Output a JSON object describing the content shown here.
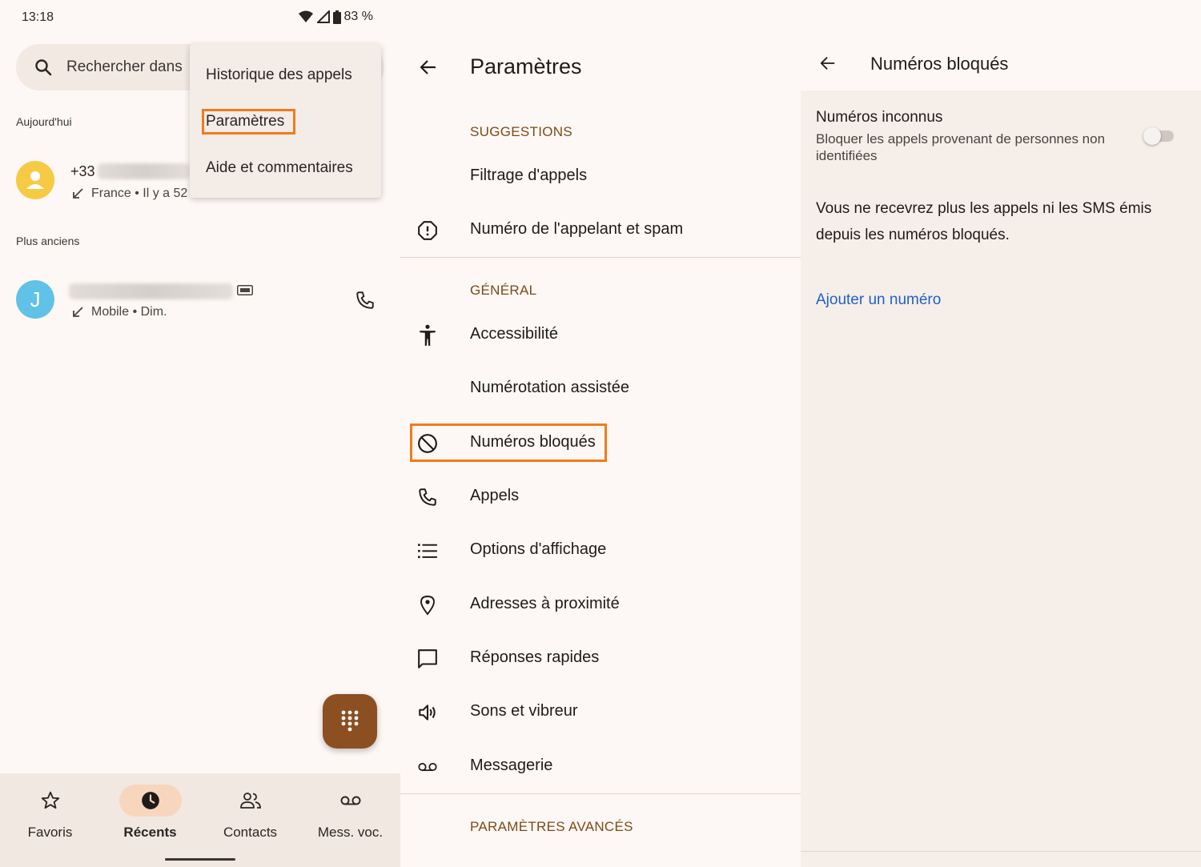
{
  "status": {
    "time": "13:18",
    "battery": "83 %"
  },
  "recents": {
    "search_placeholder": "Rechercher dans",
    "section_today": "Aujourd'hui",
    "section_older": "Plus anciens",
    "call1": {
      "number_prefix": "+33",
      "subtitle": "France • Il y a 52"
    },
    "call2": {
      "avatar_letter": "J",
      "subtitle": "Mobile • Dim."
    },
    "menu": [
      {
        "label": "Historique des appels"
      },
      {
        "label": "Paramètres"
      },
      {
        "label": "Aide et commentaires"
      }
    ],
    "nav": [
      {
        "label": "Favoris",
        "icon": "star-icon"
      },
      {
        "label": "Récents",
        "icon": "clock-icon"
      },
      {
        "label": "Contacts",
        "icon": "people-icon"
      },
      {
        "label": "Mess. voc.",
        "icon": "voicemail-icon"
      }
    ],
    "active_nav": "Récents",
    "colors": {
      "accent_highlight": "#f07b1d",
      "fab": "#8b4f22",
      "nav_active_pill": "#f8d6bd"
    }
  },
  "settings": {
    "title": "Paramètres",
    "sections": {
      "suggestions": "SUGGESTIONS",
      "general": "GÉNÉRAL",
      "advanced": "PARAMÈTRES AVANCÉS"
    },
    "items": [
      {
        "label": "Filtrage d'appels",
        "icon": ""
      },
      {
        "label": "Numéro de l'appelant et spam",
        "icon": "alert-octagon-icon"
      },
      {
        "label": "Accessibilité",
        "icon": "accessibility-icon"
      },
      {
        "label": "Numérotation assistée",
        "icon": ""
      },
      {
        "label": "Numéros bloqués",
        "icon": "block-icon"
      },
      {
        "label": "Appels",
        "icon": "phone-icon"
      },
      {
        "label": "Options d'affichage",
        "icon": "list-icon"
      },
      {
        "label": "Adresses à proximité",
        "icon": "location-pin-icon"
      },
      {
        "label": "Réponses rapides",
        "icon": "chat-bubble-icon"
      },
      {
        "label": "Sons et vibreur",
        "icon": "speaker-icon"
      },
      {
        "label": "Messagerie",
        "icon": "voicemail-icon"
      }
    ]
  },
  "blocked": {
    "title": "Numéros bloqués",
    "unknown_title": "Numéros inconnus",
    "unknown_subtitle": "Bloquer les appels provenant de personnes non identifiées",
    "unknown_enabled": false,
    "info": "Vous ne recevrez plus les appels ni les SMS émis depuis les numéros bloqués.",
    "add_link": "Ajouter un numéro",
    "colors": {
      "link": "#1f5fcf"
    }
  }
}
